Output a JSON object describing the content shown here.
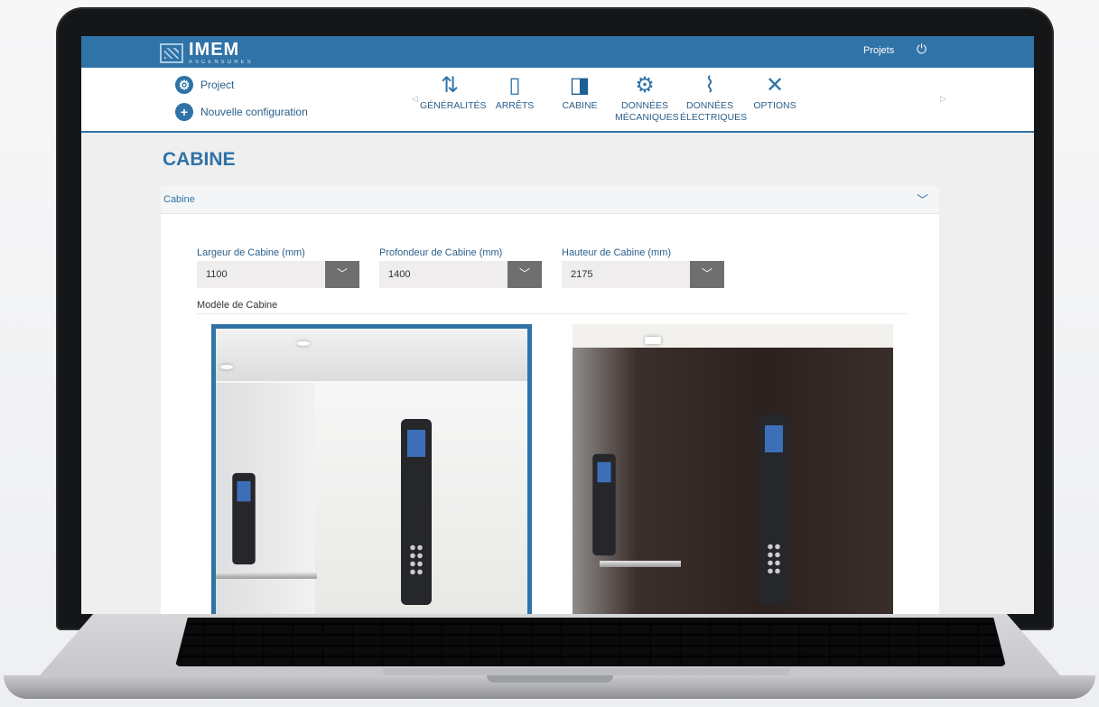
{
  "header": {
    "brand_name": "IMEM",
    "brand_sub": "ASCENSORES",
    "projects_link": "Projets",
    "power_icon": "power-icon",
    "accent_color": "#2f73a7"
  },
  "sidebar": {
    "project_link": "Project",
    "new_config_link": "Nouvelle configuration"
  },
  "steps": [
    {
      "line1": "GÉNÉRALITÉS",
      "line2": "",
      "icon": "elevator-arrows-icon"
    },
    {
      "line1": "ARRÊTS",
      "line2": "",
      "icon": "door-icon"
    },
    {
      "line1": "CABINE",
      "line2": "",
      "icon": "cabin-icon"
    },
    {
      "line1": "DONNÉES",
      "line2": "MÉCANIQUES",
      "icon": "gears-icon"
    },
    {
      "line1": "DONNÉES",
      "line2": "ÉLECTRIQUES",
      "icon": "cable-icon"
    },
    {
      "line1": "OPTIONS",
      "line2": "",
      "icon": "tools-icon"
    }
  ],
  "page": {
    "title": "CABINE"
  },
  "panel": {
    "title": "Cabine",
    "fields": {
      "width": {
        "label": "Largeur de Cabine (mm)",
        "value": "1100"
      },
      "depth": {
        "label": "Profondeur de Cabine (mm)",
        "value": "1400"
      },
      "height": {
        "label": "Hauteur de Cabine (mm)",
        "value": "2175"
      }
    },
    "model_label": "Modèle de Cabine"
  }
}
